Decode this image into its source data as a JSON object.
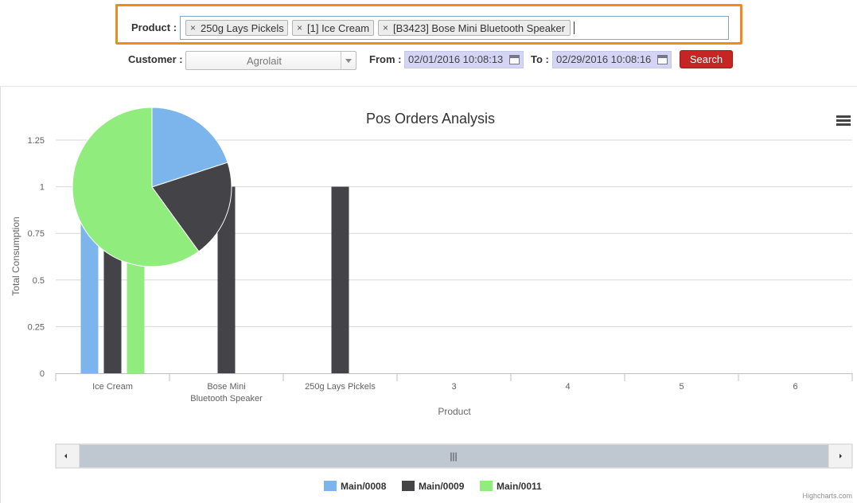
{
  "filters": {
    "product_label": "Product :",
    "product_tags": [
      "250g Lays Pickels",
      "[1] Ice Cream",
      "[B3423] Bose Mini Bluetooth Speaker"
    ],
    "remove_glyph": "×",
    "customer_label": "Customer :",
    "customer_value": "Agrolait",
    "from_label": "From :",
    "from_value": "02/01/2016 10:08:13",
    "to_label": "To :",
    "to_value": "02/29/2016 10:08:16",
    "search_label": "Search"
  },
  "icons": {
    "menu": "hamburger-menu-icon",
    "calendar": "calendar-icon",
    "remove": "close-icon",
    "dropdown": "chevron-down-icon"
  },
  "chart_data": [
    {
      "type": "bar",
      "title": "Pos Orders Analysis",
      "xlabel": "Product",
      "ylabel": "Total Consumption",
      "categories": [
        "Ice Cream",
        "Bose Mini Bluetooth Speaker",
        "250g Lays Pickels",
        "3",
        "4",
        "5",
        "6"
      ],
      "ylim": [
        0,
        1.25
      ],
      "yticks": [
        "0",
        "0.25",
        "0.5",
        "0.75",
        "1",
        "1.25"
      ],
      "grid": true,
      "legend": "bottom-center",
      "series": [
        {
          "name": "Main/0008",
          "color": "#7cb5ec",
          "values": [
            1,
            0,
            0,
            null,
            null,
            null,
            null
          ]
        },
        {
          "name": "Main/0009",
          "color": "#434348",
          "values": [
            1,
            1,
            1,
            null,
            null,
            null,
            null
          ]
        },
        {
          "name": "Main/0011",
          "color": "#90ed7d",
          "values": [
            1,
            0,
            0,
            null,
            null,
            null,
            null
          ]
        }
      ]
    },
    {
      "type": "pie",
      "slices": [
        {
          "color": "#7cb5ec",
          "value": 20
        },
        {
          "color": "#434348",
          "value": 20
        },
        {
          "color": "#90ed7d",
          "value": 60
        }
      ]
    }
  ],
  "credits": "Highcharts.com",
  "scrollbar": {
    "grip": "|||"
  }
}
